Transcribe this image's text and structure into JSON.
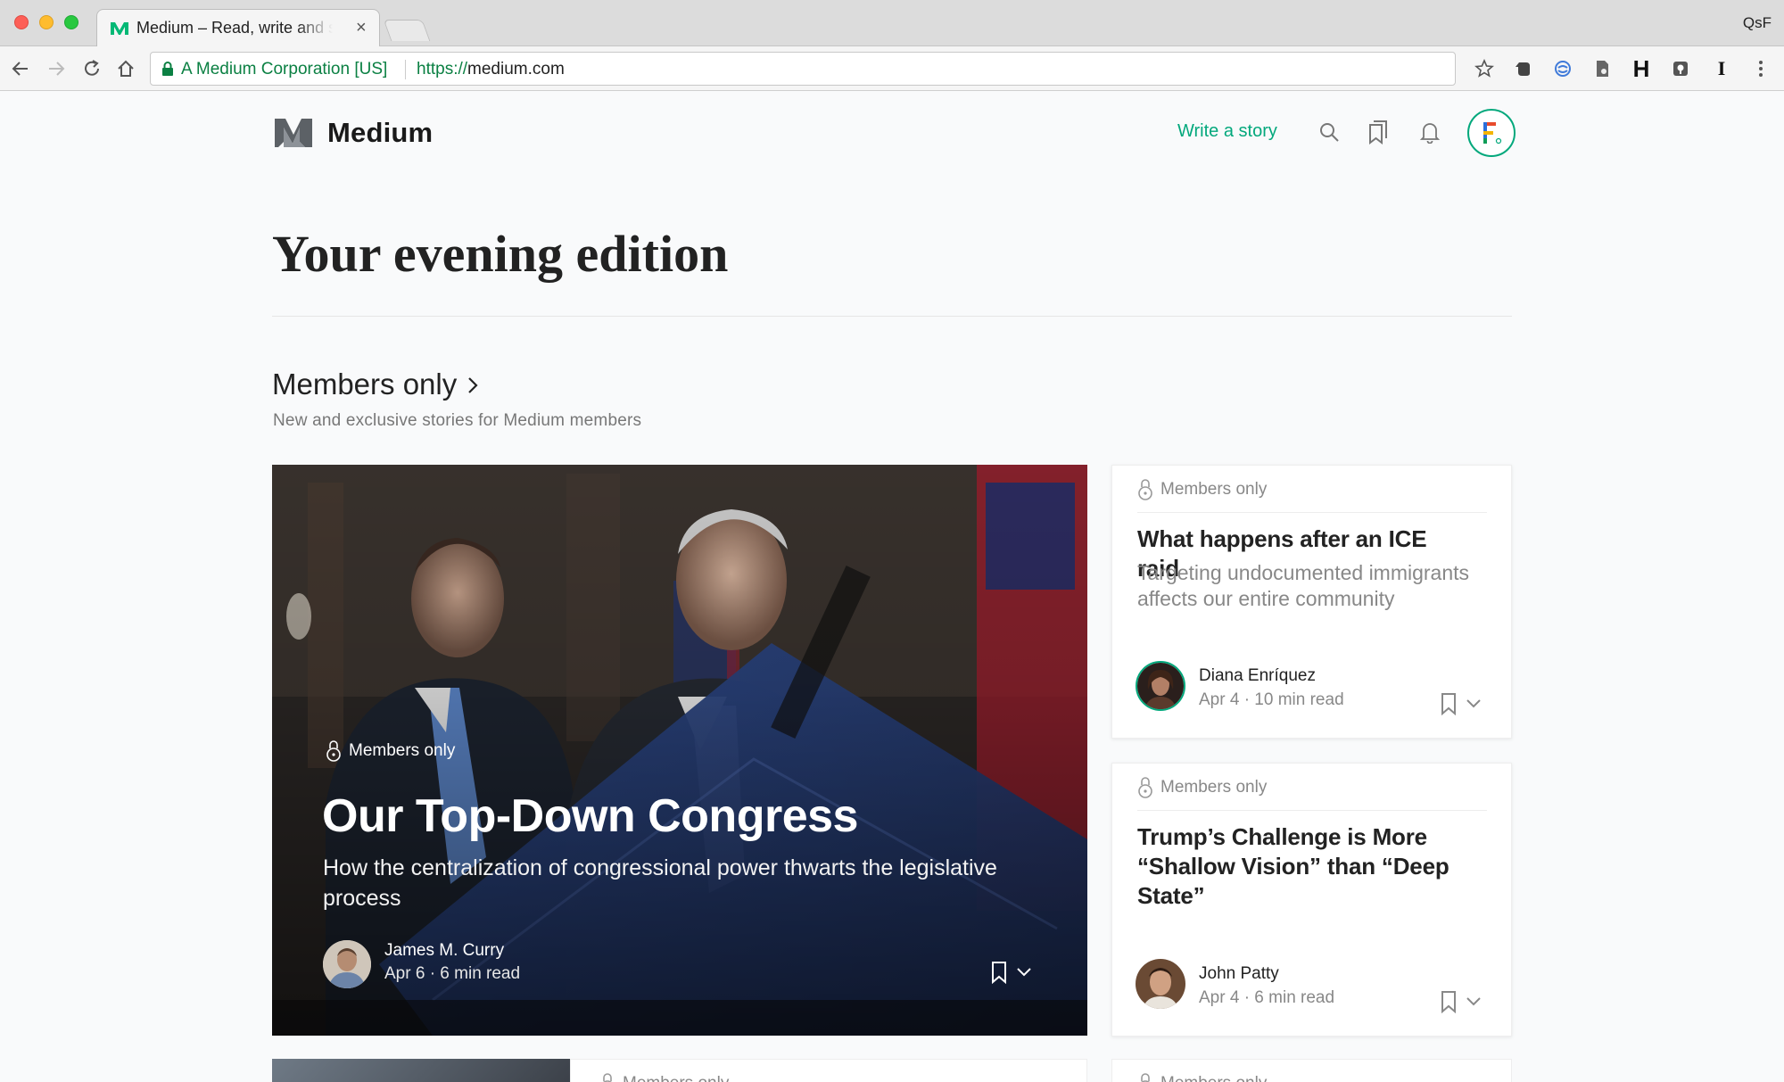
{
  "browser": {
    "tab_title": "Medium – Read, write and share stories that matter",
    "profile": "QsF",
    "secure_label": "A Medium Corporation [US]",
    "url_scheme": "https://",
    "url_host": "medium.com"
  },
  "header": {
    "brand": "Medium",
    "write_link": "Write a story"
  },
  "page": {
    "title": "Your evening edition"
  },
  "section": {
    "title": "Members only",
    "subtitle": "New and exclusive stories for Medium members"
  },
  "featured": {
    "badge": "Members only",
    "title": "Our Top-Down Congress",
    "subtitle": "How the centralization of congressional power thwarts the legislative process",
    "author": "James M. Curry",
    "meta": "Apr 6 · 6 min read"
  },
  "side_cards": [
    {
      "badge": "Members only",
      "title": "What happens after an ICE raid",
      "subtitle": "Targeting undocumented immigrants affects our entire community",
      "author": "Diana Enríquez",
      "meta": "Apr 4 · 10 min read"
    },
    {
      "badge": "Members only",
      "title": "Trump’s Challenge is More “Shallow Vision” than “Deep State”",
      "subtitle": "",
      "author": "John Patty",
      "meta": "Apr 4 · 6 min read"
    }
  ],
  "bottom_cards": [
    {
      "badge": "Members only"
    },
    {
      "badge": "Members only"
    }
  ],
  "colors": {
    "accent": "#03a87c",
    "secure_green": "#0b8043"
  }
}
